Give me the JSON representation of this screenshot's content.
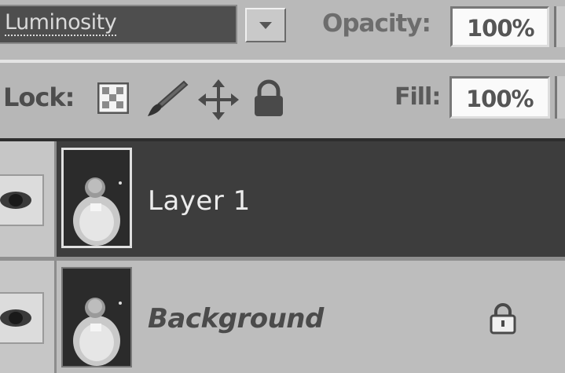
{
  "blend_mode": {
    "value": "Luminosity"
  },
  "opacity": {
    "label": "Opacity:",
    "value": "100%"
  },
  "lock": {
    "label": "Lock:"
  },
  "fill": {
    "label": "Fill:",
    "value": "100%"
  },
  "layers": [
    {
      "name": "Layer 1",
      "selected": true,
      "visible": true,
      "locked": false
    },
    {
      "name": "Background",
      "selected": false,
      "visible": true,
      "locked": true
    }
  ],
  "colors": {
    "panel_bg": "#b6b6b6",
    "selected_row": "#3d3d3d",
    "selected_text": "#ececec"
  },
  "icons": [
    "lock-transparent-pixels-icon",
    "lock-image-pixels-icon",
    "lock-position-icon",
    "lock-all-icon",
    "eye-icon",
    "padlock-icon",
    "dropdown-arrow-icon"
  ]
}
